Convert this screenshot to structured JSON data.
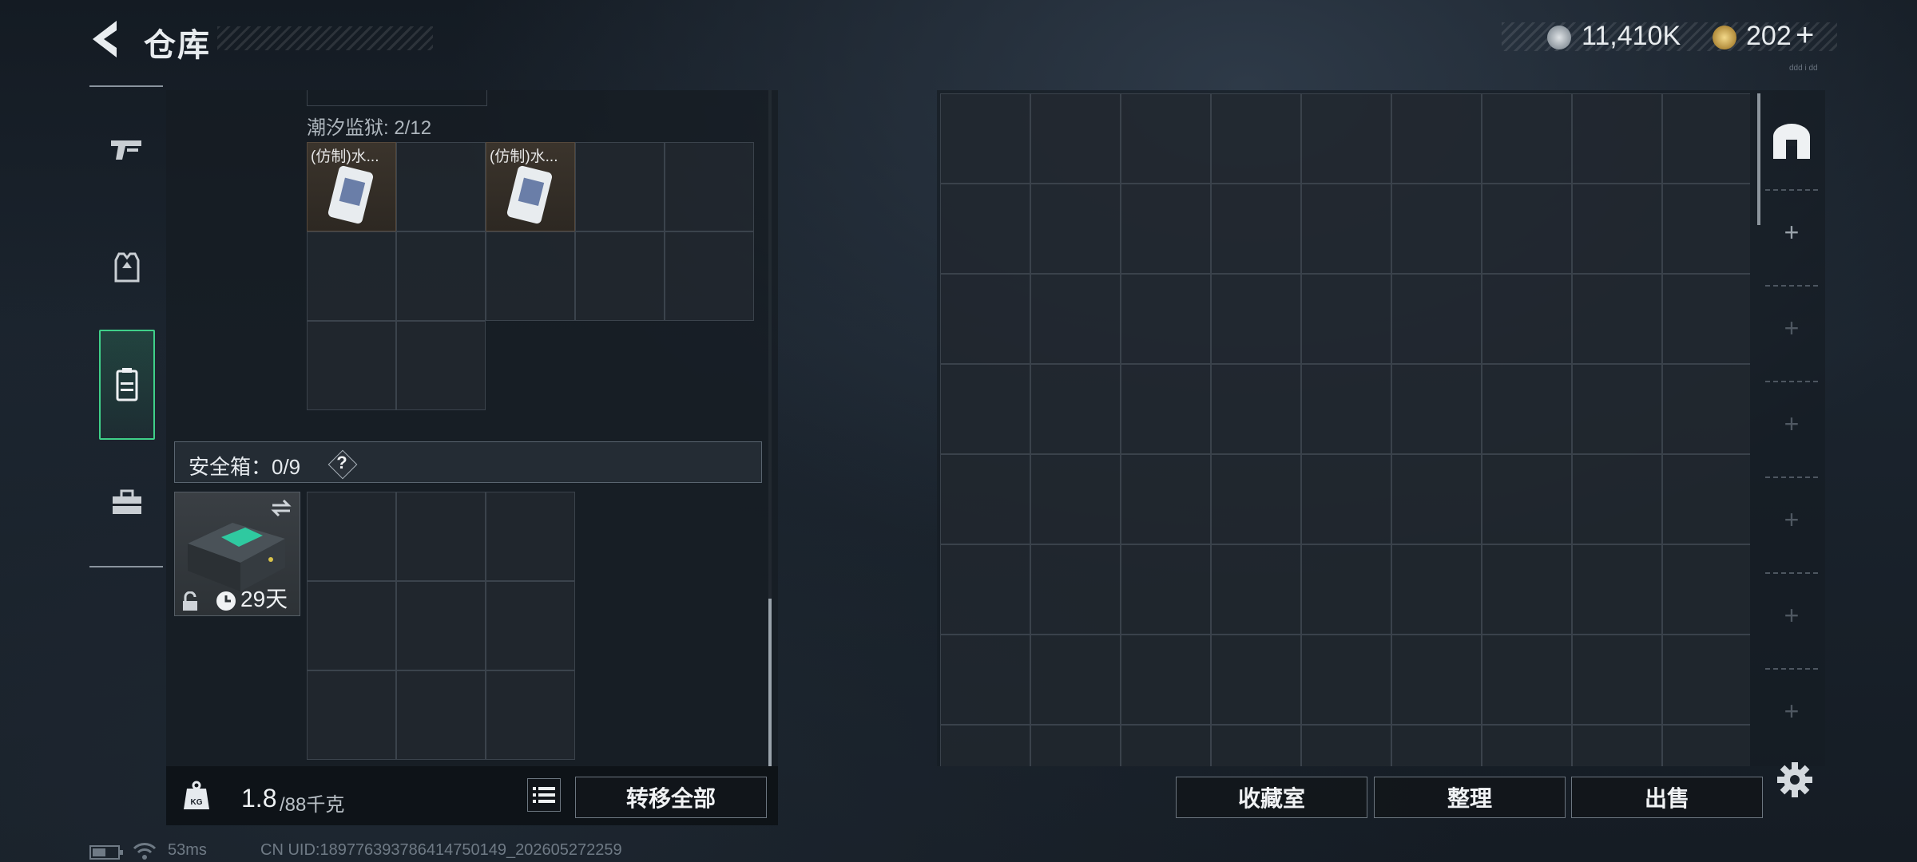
{
  "header": {
    "title": "仓库",
    "currency_silver": "11,410K",
    "currency_gold": "202",
    "plus_symbol": "+",
    "tiny_label": "ddd i dd"
  },
  "nav": {
    "items": [
      "weapons",
      "gear",
      "backpack",
      "toolbox"
    ],
    "active": "backpack"
  },
  "left": {
    "container_label": "潮汐监狱: 2/12",
    "items": [
      {
        "name": "(仿制)水..."
      },
      {
        "name": "(仿制)水..."
      }
    ],
    "safe_box_label": "安全箱：0/9",
    "help_symbol": "?",
    "safe_case_days": "29天",
    "weight_current": "1.8",
    "weight_max": "/88千克",
    "transfer_all": "转移全部"
  },
  "right": {
    "buttons": [
      "收藏室",
      "整理",
      "出售"
    ]
  },
  "status": {
    "ping": "53ms",
    "uid": "CN UID:189776393786414750149_202605272259"
  },
  "colors": {
    "accent_green": "#3fd089",
    "item_bg": "#3b342c"
  }
}
